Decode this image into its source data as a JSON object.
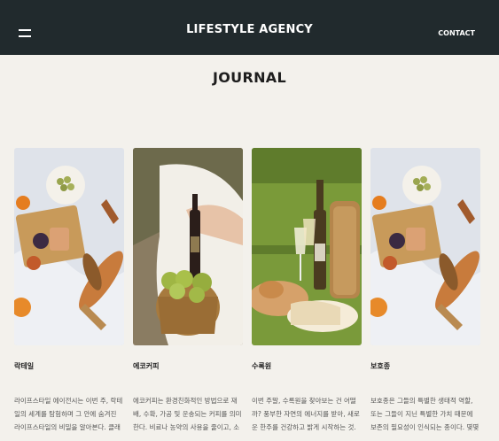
{
  "header": {
    "brand": "LIFESTYLE AGENCY",
    "contact_label": "CONTACT",
    "menu_icon": "hamburger-icon"
  },
  "journal": {
    "title": "JOURNAL",
    "posts": [
      {
        "title": "락테일",
        "excerpt": "라이프스타일 에이전시는 이번 주, 락테일의 세계를 탐험하며 그 안에 숨겨진 라이프스타일의 비밀을 알아본다. 클래식 락테일에서부터 현 ..."
      },
      {
        "title": "에코커피",
        "excerpt": "에코커피는 환경친화적인 방법으로 재배, 수확, 가공 및 운송되는 커피를 의미한다. 비료나 농약의 사용을 줄이고, 소비자와 생산자 사이 ..."
      },
      {
        "title": "수록원",
        "excerpt": "이번 주말, 수록원을 찾아보는 건 어떨까? 풍부한 자연의 에너지를 받아, 새로운 한주를 건강하고 밝게 시작하는 것. 그것이 바로 라이프 ..."
      },
      {
        "title": "보호종",
        "excerpt": "보호종은 그들의 특별한 생태적 역할, 또는 그들이 지닌 특별한 가치 때문에 보존의 필요성이 인식되는 종이다. 몇몇은 자연의 변화로, 또 ..."
      }
    ]
  }
}
